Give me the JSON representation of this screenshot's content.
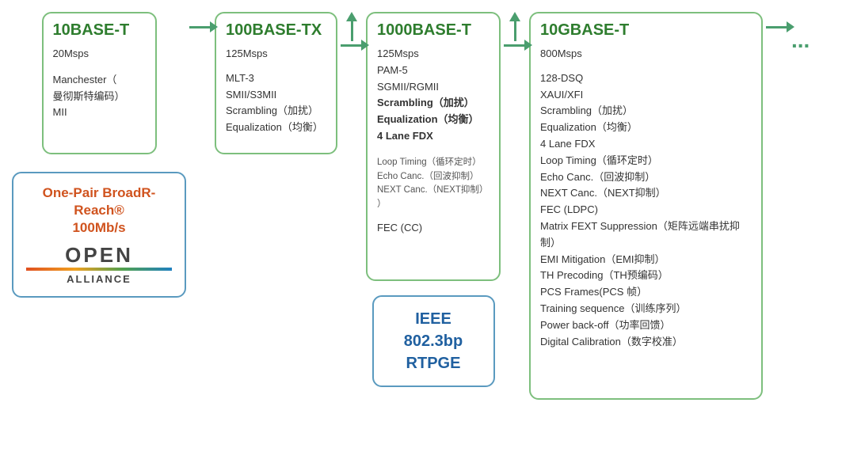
{
  "boxes": [
    {
      "id": "10base-t",
      "title": "10BASE-T",
      "lines": [
        "20Msps",
        "",
        "Manchester（",
        "曼彻斯特编码）",
        "MII"
      ]
    },
    {
      "id": "100base-tx",
      "title": "100BASE-TX",
      "lines": [
        "125Msps",
        "",
        "MLT-3",
        "SMII/S3MII",
        "Scrambling（加扰）",
        "Equalization（均衡）"
      ]
    },
    {
      "id": "1000base-t",
      "title": "1000BASE-T",
      "lines_top": [
        "125Msps",
        "PAM-5",
        "SGMII/RGMII",
        "Scrambling（加扰）",
        "Equalization（均衡）",
        "4 Lane FDX"
      ],
      "lines_bottom": [
        "Loop Timing（循环定时）",
        "Echo Canc.（回波抑制）",
        "NEXT Canc.（NEXT抑制）",
        "",
        "FEC (CC)"
      ]
    },
    {
      "id": "10gbase-t",
      "title": "10GBASE-T",
      "lines": [
        "800Msps",
        "",
        "128-DSQ",
        "XAUI/XFI",
        "Scrambling（加扰）",
        "Equalization（均衡）",
        "4 Lane FDX",
        "Loop Timing（循环定时）",
        "Echo Canc.（回波抑制）",
        "NEXT Canc.（NEXT抑制）",
        "FEC (LDPC)",
        "Matrix FEXT Suppression（矩阵远端串扰抑制）",
        "EMI Mitigation（EMI抑制）",
        "TH Precoding（TH预编码）",
        "PCS Frames(PCS 帧）",
        "Training sequence（训练序列）",
        "Power back-off（功率回馈）",
        "Digital Calibration（数字校准）"
      ]
    }
  ],
  "onepair": {
    "title": "One-Pair BroadR-Reach®\n100Mb/s",
    "logo_open": "OPEN",
    "logo_alliance": "ALLIANCE"
  },
  "ieee": {
    "title": "IEEE 802.3bp\nRTPGE"
  },
  "dots": "..."
}
